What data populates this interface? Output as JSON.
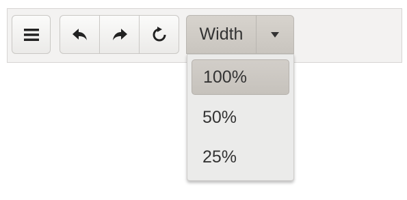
{
  "toolbar": {
    "menu_icon": "hamburger-icon",
    "undo_icon": "undo-arrow-icon",
    "redo_icon": "redo-arrow-icon",
    "refresh_icon": "refresh-icon",
    "width_dropdown": {
      "label": "Width",
      "caret_icon": "caret-down-icon",
      "expanded": true
    }
  },
  "dropdown_menu": {
    "items": [
      {
        "label": "100%",
        "selected": true
      },
      {
        "label": "50%",
        "selected": false
      },
      {
        "label": "25%",
        "selected": false
      }
    ]
  },
  "colors": {
    "toolbar_bg": "#f3f2f1",
    "active_bg": "#ccc8c2",
    "menu_bg": "#ebebea",
    "text": "#333333"
  }
}
